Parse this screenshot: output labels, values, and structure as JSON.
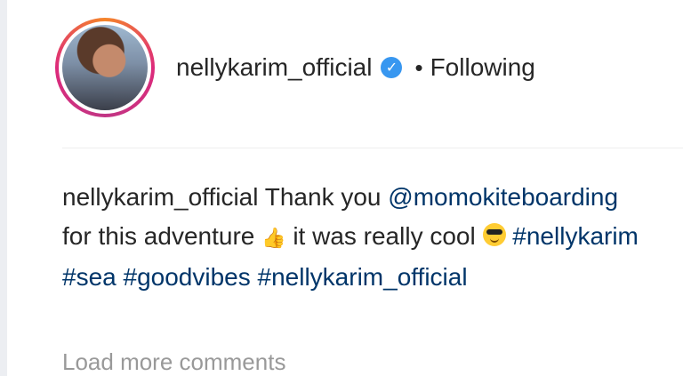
{
  "post_header": {
    "username": "nellykarim_official",
    "verified_icon": "verified-check-icon",
    "separator": "•",
    "follow_status": "Following"
  },
  "caption": {
    "author": "nellykarim_official",
    "text_1": "Thank you",
    "mention": "@momokiteboarding",
    "text_2": "for this adventure",
    "text_3": "it was really cool",
    "hashtags": [
      "#nellykarim",
      "#sea",
      "#goodvibes",
      "#nellykarim_official"
    ]
  },
  "comments": {
    "load_more_label": "Load more comments"
  },
  "colors": {
    "link": "#003569",
    "verified": "#3897f0",
    "muted": "#999999"
  }
}
